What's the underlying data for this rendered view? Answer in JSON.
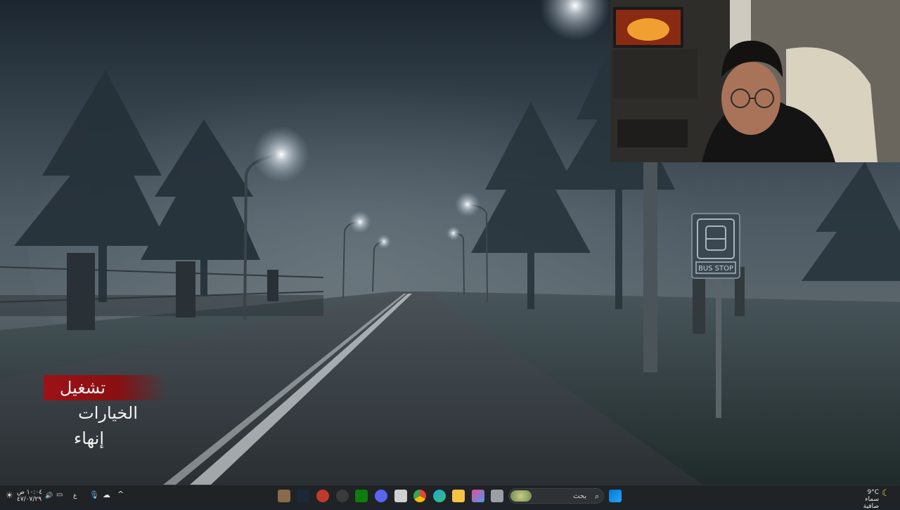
{
  "game": {
    "menu": [
      {
        "label": "تشغيل"
      },
      {
        "label": "الخيارات"
      },
      {
        "label": "إنهاء"
      }
    ],
    "sign_text": "BUS STOP"
  },
  "taskbar": {
    "search_placeholder": "بحث",
    "time": "١٠:٠٤ ص",
    "date": "٤٧/٠٧/٢٩",
    "language": "ع",
    "weather_temp": "9°C",
    "weather_desc": "سماء صافية"
  },
  "colors": {
    "menu_highlight": "#9c1216",
    "taskbar_bg": "#202326"
  }
}
